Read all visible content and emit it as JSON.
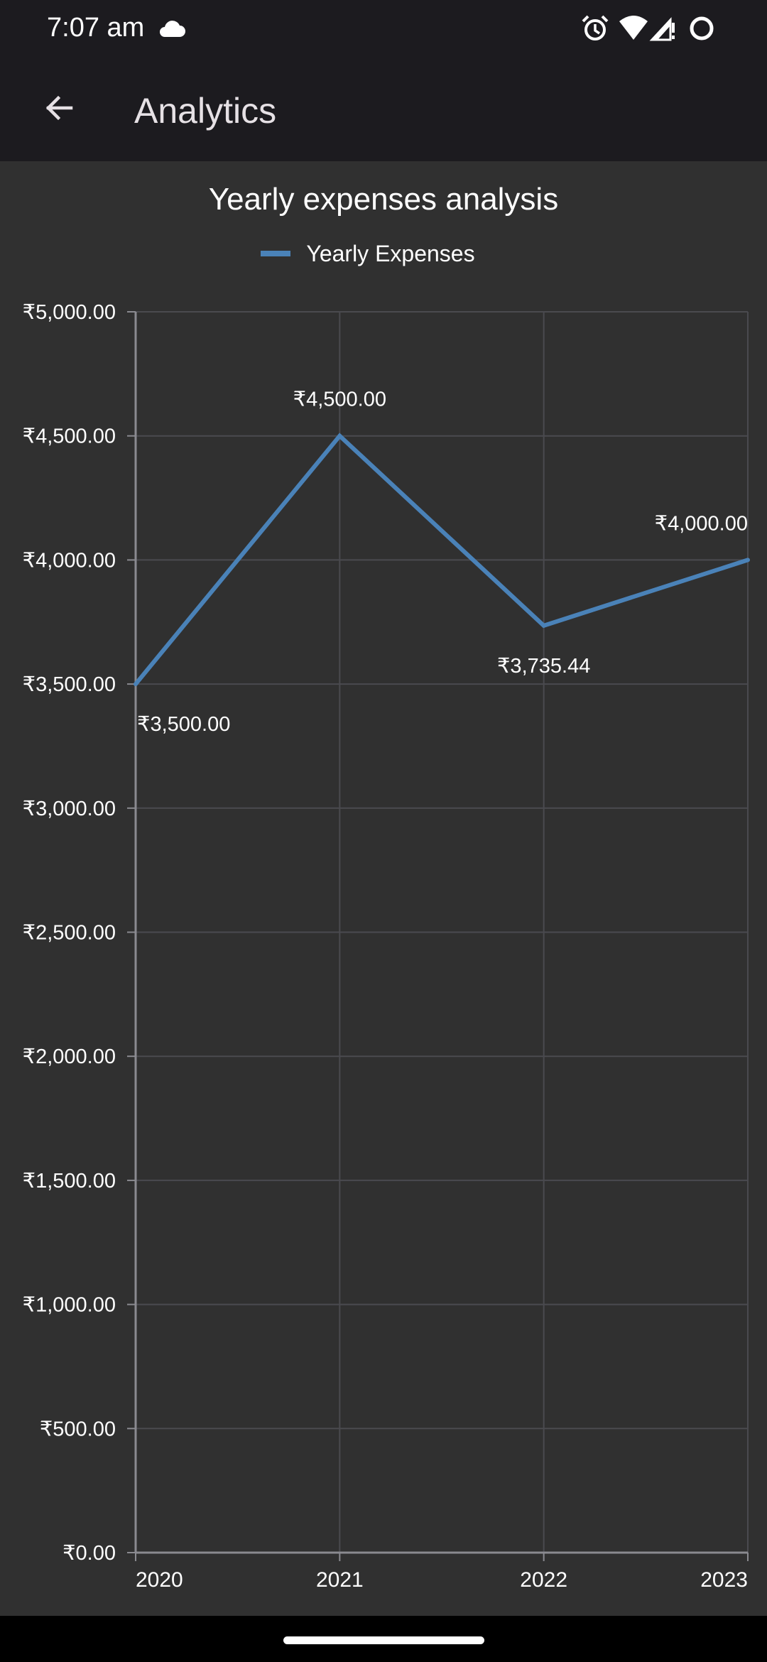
{
  "status_bar": {
    "time": "7:07 am",
    "icons": [
      "cloud-icon",
      "alarm-icon",
      "wifi-icon",
      "signal-icon",
      "battery-icon"
    ]
  },
  "app_bar": {
    "back_icon": "arrow-back-icon",
    "title": "Analytics"
  },
  "colors": {
    "series": "#4a82b8",
    "background": "#303030",
    "grid": "#4a4a4f",
    "axis": "#8a8a90"
  },
  "chart_data": {
    "type": "line",
    "title": "Yearly expenses analysis",
    "xlabel": "",
    "ylabel": "",
    "categories": [
      "2020",
      "2021",
      "2022",
      "2023"
    ],
    "series": [
      {
        "name": "Yearly Expenses",
        "values": [
          3500.0,
          4500.0,
          3735.44,
          4000.0
        ],
        "data_labels": [
          "₹3,500.00",
          "₹4,500.00",
          "₹3,735.44",
          "₹4,000.00"
        ]
      }
    ],
    "ylim": [
      0,
      5000
    ],
    "y_ticks": [
      0,
      500,
      1000,
      1500,
      2000,
      2500,
      3000,
      3500,
      4000,
      4500,
      5000
    ],
    "y_tick_labels": [
      "₹0.00",
      "₹500.00",
      "₹1,000.00",
      "₹1,500.00",
      "₹2,000.00",
      "₹2,500.00",
      "₹3,000.00",
      "₹3,500.00",
      "₹4,000.00",
      "₹4,500.00",
      "₹5,000.00"
    ],
    "grid": true,
    "legend": "top-center"
  }
}
